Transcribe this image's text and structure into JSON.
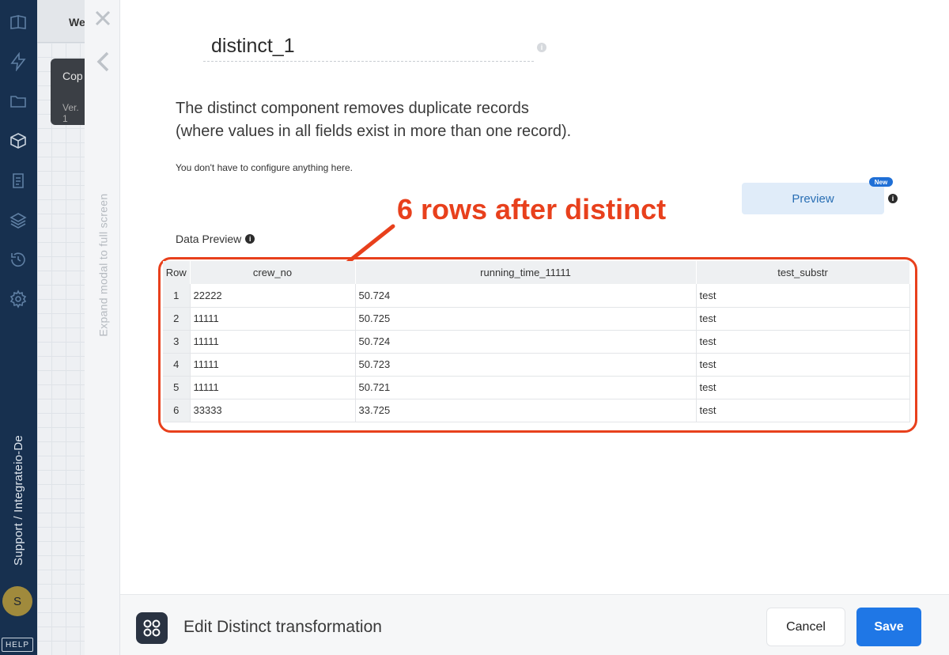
{
  "sidebar": {
    "icons": [
      "logo-icon",
      "bolt-icon",
      "folder-icon",
      "package-icon",
      "clipboard-icon",
      "layers-icon",
      "history-icon",
      "settings-icon"
    ],
    "org_label": "Support / Integrateio-De",
    "avatar_initial": "S",
    "help_label": "HELP"
  },
  "background": {
    "tab_label": "We",
    "card_title": "Cop",
    "card_version": "Ver. 1"
  },
  "modal": {
    "expand_label": "Expand modal to full screen",
    "component_name": "distinct_1",
    "description_line1": "The distinct component removes duplicate records",
    "description_line2": "(where values in all fields exist in more than one record).",
    "sub_note": "You don't have to configure anything here.",
    "preview_button": "Preview",
    "new_badge": "New",
    "data_preview_label": "Data Preview",
    "annotation": "6 rows after distinct"
  },
  "table": {
    "columns": [
      "Row",
      "crew_no",
      "running_time_11111",
      "test_substr"
    ],
    "rows": [
      [
        "1",
        "22222",
        "50.724",
        "test"
      ],
      [
        "2",
        "11111",
        "50.725",
        "test"
      ],
      [
        "3",
        "11111",
        "50.724",
        "test"
      ],
      [
        "4",
        "11111",
        "50.723",
        "test"
      ],
      [
        "5",
        "11111",
        "50.721",
        "test"
      ],
      [
        "6",
        "33333",
        "33.725",
        "test"
      ]
    ]
  },
  "footer": {
    "title": "Edit Distinct transformation",
    "cancel_label": "Cancel",
    "save_label": "Save"
  },
  "colors": {
    "sidebar_bg": "#17304f",
    "annotation_red": "#e8401c",
    "save_blue": "#1f77e6",
    "preview_bg": "#e0ecf9"
  }
}
